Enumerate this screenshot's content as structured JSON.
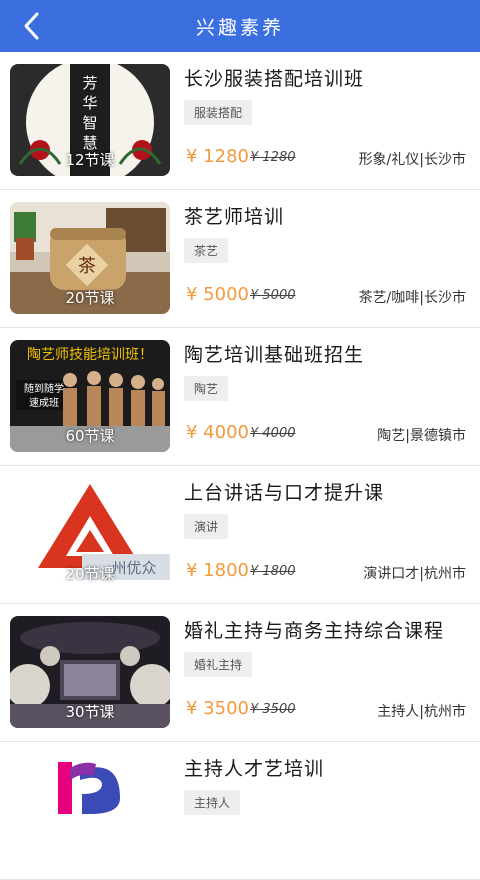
{
  "header": {
    "title": "兴趣素养",
    "back_icon": "chevron-left-icon",
    "color": "#3b6fe0"
  },
  "courses": [
    {
      "title": "长沙服装搭配培训班",
      "tag": "服装搭配",
      "price": "¥ 1280",
      "old_price": "¥ 1280",
      "meta": "形象/礼仪|长沙市",
      "lessons": "12节课",
      "thumb_text": "芳华 智慧 学"
    },
    {
      "title": "茶艺师培训",
      "tag": "茶艺",
      "price": "¥ 5000",
      "old_price": "¥ 5000",
      "meta": "茶艺/咖啡|长沙市",
      "lessons": "20节课",
      "thumb_text": "茶"
    },
    {
      "title": "陶艺培训基础班招生",
      "tag": "陶艺",
      "price": "¥ 4000",
      "old_price": "¥ 4000",
      "meta": "陶艺|景德镇市",
      "lessons": "60节课",
      "thumb_text": "陶艺师技能培训班！",
      "thumb_subtext": "随到随学 速成班"
    },
    {
      "title": "上台讲话与口才提升课",
      "tag": "演讲",
      "price": "¥ 1800",
      "old_price": "¥ 1800",
      "meta": "演讲口才|杭州市",
      "lessons": "20节课",
      "thumb_text": "州优众"
    },
    {
      "title": "婚礼主持与商务主持综合课程",
      "tag": "婚礼主持",
      "price": "¥ 3500",
      "old_price": "¥ 3500",
      "meta": "主持人|杭州市",
      "lessons": "30节课"
    },
    {
      "title": "主持人才艺培训",
      "tag": "主持人",
      "price": "",
      "old_price": "",
      "meta": "",
      "lessons": ""
    }
  ]
}
